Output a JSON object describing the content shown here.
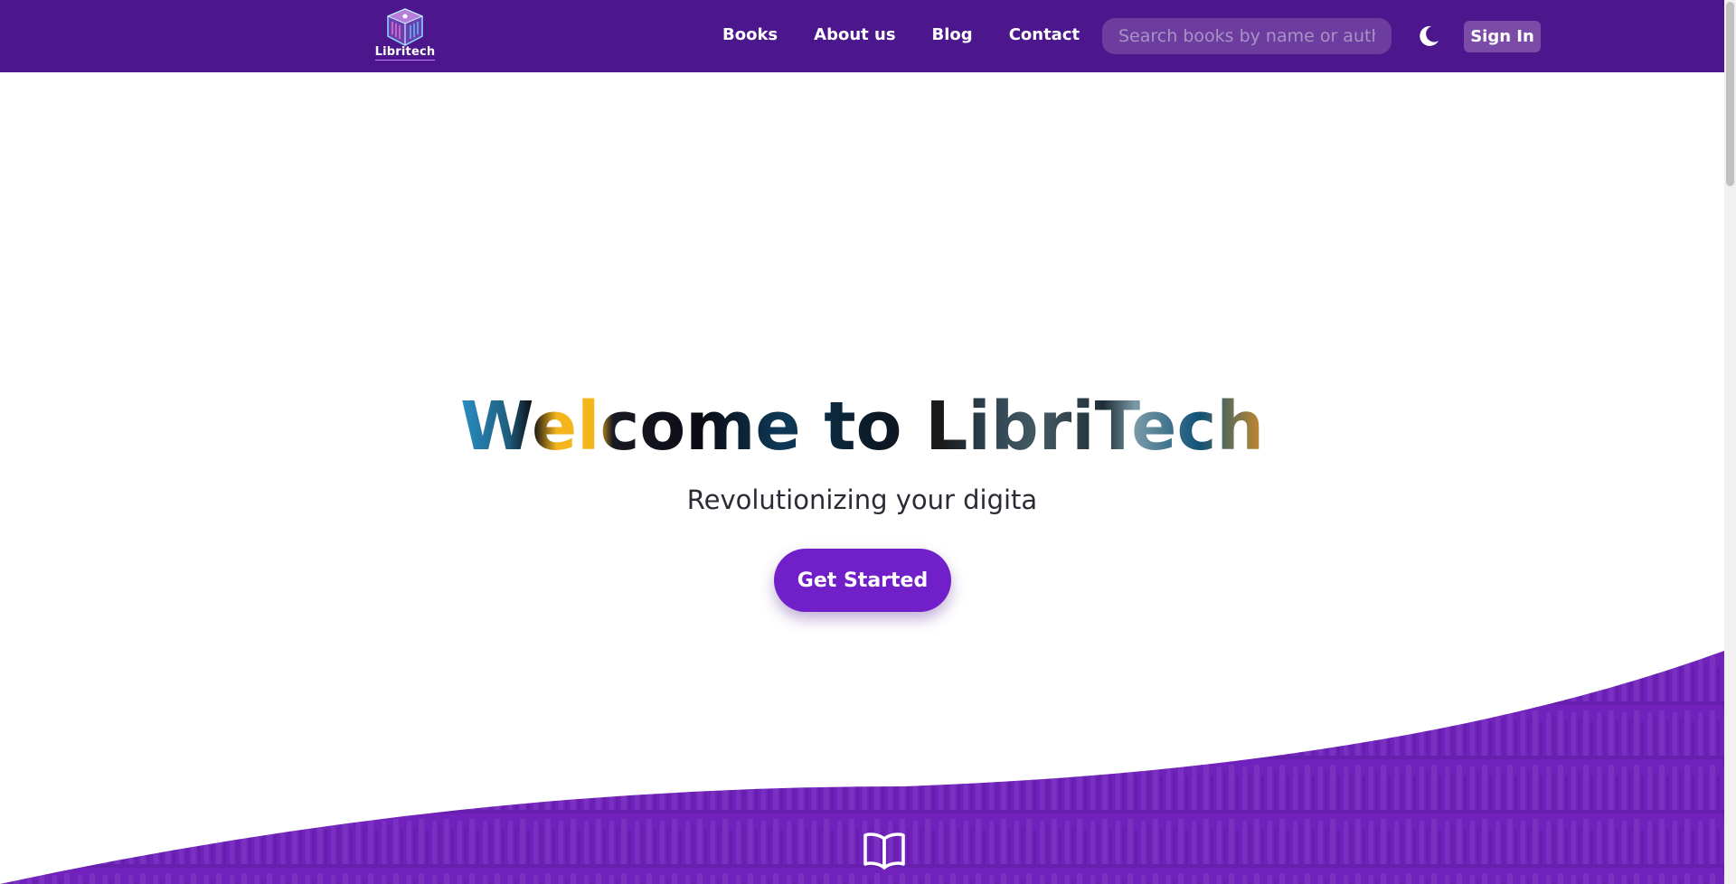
{
  "nav": {
    "logo_text": "Libritech",
    "links": [
      {
        "label": "Books"
      },
      {
        "label": "About us"
      },
      {
        "label": "Blog"
      },
      {
        "label": "Contact"
      }
    ],
    "search_placeholder": "Search books by name or author",
    "theme_icon": "moon-icon",
    "signin_label": "Sign In"
  },
  "hero": {
    "title": "Welcome to LibriTech",
    "subtitle": "Revolutionizing your digita",
    "cta_label": "Get Started"
  },
  "feature": {
    "icon": "open-book-icon"
  },
  "colors": {
    "nav_bg": "#4c168c",
    "accent": "#7120c9",
    "wave": "#6f22b8"
  }
}
